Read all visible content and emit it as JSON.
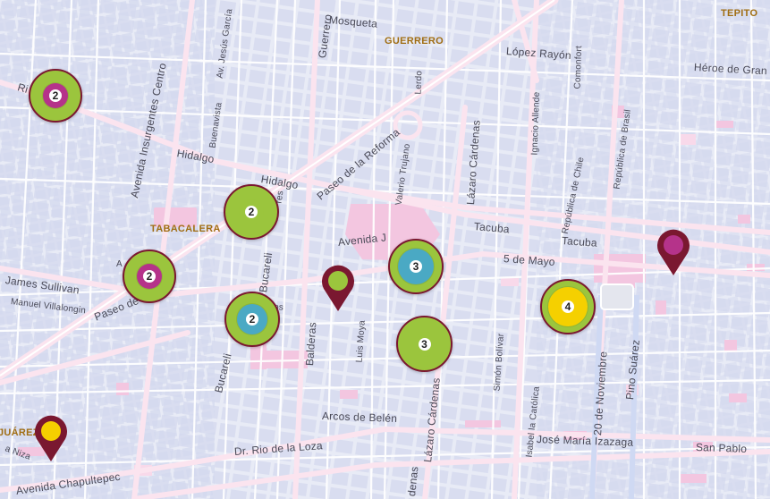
{
  "map": {
    "neighborhoods": {
      "guerrero": "GUERRERO",
      "tepito": "TEPITO",
      "tabacalera": "TABACALERA",
      "juarez": "JUÁREZ"
    },
    "streets": {
      "mosqueta": "Mosqueta",
      "lopez_rayon": "López Rayón",
      "heroe_granaditas": "Héroe de Gran",
      "rivera_san_cosme": "Ri  n Cosme",
      "hidalgo_left": "Hidalgo",
      "hidalgo_right": "Hidalgo",
      "paseo_reforma_top": "Paseo de la Reforma",
      "paseo_reforma_bottom": "Paseo de  rma",
      "tacuba_left": "Tacuba",
      "tacuba_right": "Tacuba",
      "avenida_juarez": "Avenida J",
      "cinco_mayo": "5 de Mayo",
      "james_sullivan": "James Sullivan",
      "manuel_villalongin": "Manuel Villalongin",
      "arcos_belen": "Arcos de Belén",
      "jose_maria_izazaga": "José María Izazaga",
      "san_pablo": "San Pablo",
      "dr_rio_loza": "Dr. Rio de la Loza",
      "avenida_chapultepec": "Avenida Chapultepec",
      "av_nizá": "a Niza",
      "avenida_insurgentes": "Avenida Insurgentes Centro",
      "av_jesus_garcia": "Av. Jesús García",
      "buenavista": "Buenavista",
      "guerrero_st": "Guerrero",
      "lerdo": "Lerdo",
      "valerio_trujano": "Valerio Trujano",
      "lazaro_cardenas_top": "Lázaro Cárdenas",
      "lazaro_cardenas_bottom": "Lázaro Cárdenas",
      "ignacio_allende": "Ignacio Allende",
      "comonfort": "Comonfort",
      "republica_brasil": "República de Brasil",
      "republica_chile": "República de Chile",
      "bucareli_top": "Bucareli",
      "bucareli_bottom": "Bucareli",
      "balderas": "Balderas",
      "luis_moya": "Luis Moya",
      "simon_bolivar": "Simón Bolívar",
      "isabel_catolica": "Isabel la Católica",
      "veinte_noviembre": "20 de Noviembre",
      "pino_suarez": "Pino Suárez",
      "denas": "denas",
      "res_fragment": "res",
      "os_fragment": "os",
      "a_fragment": "A"
    },
    "clusters": [
      {
        "id": "c1",
        "count": "2",
        "outer": "#9bc53d",
        "inner": "#b5338a"
      },
      {
        "id": "c2",
        "count": "2",
        "outer": "#9bc53d",
        "inner": "#9bc53d"
      },
      {
        "id": "c3",
        "count": "2",
        "outer": "#9bc53d",
        "inner": "#b5338a"
      },
      {
        "id": "c4",
        "count": "2",
        "outer": "#9bc53d",
        "inner": "#4aa9c4"
      },
      {
        "id": "c5",
        "count": "3",
        "outer": "#9bc53d",
        "inner": "#4aa9c4"
      },
      {
        "id": "c6",
        "count": "3",
        "outer": "#9bc53d",
        "inner": "#9bc53d"
      },
      {
        "id": "c7",
        "count": "4",
        "outer": "#9bc53d",
        "inner": "#f5d000"
      }
    ],
    "pins": [
      {
        "id": "p1",
        "color": "#9bc53d"
      },
      {
        "id": "p2",
        "color": "#b5338a"
      },
      {
        "id": "p3",
        "color": "#f5d000"
      }
    ],
    "colors": {
      "background": "#e8ebf6",
      "block": "#d7dcef",
      "road": "#ffffff",
      "major_road": "#fbe0ee",
      "park": "#f3c6e0",
      "pin_border": "#7a1830",
      "neighborhood_label": "#a06d12"
    }
  }
}
